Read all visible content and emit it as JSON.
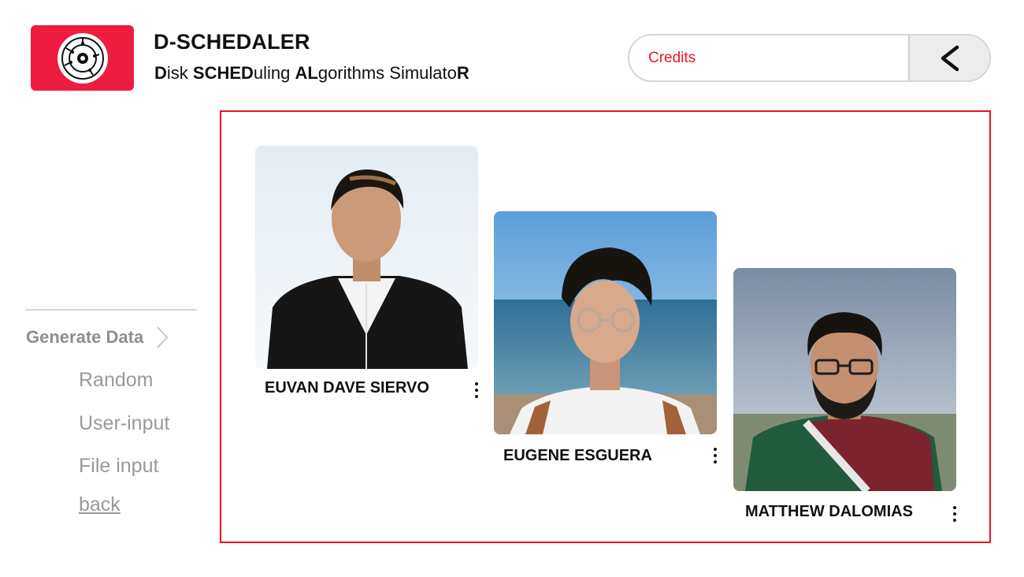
{
  "header": {
    "logo_icon": "disk-platter-icon",
    "title": "D-SCHEDALER",
    "subtitle_parts": [
      {
        "text": "D",
        "bold": true
      },
      {
        "text": "isk ",
        "bold": false
      },
      {
        "text": "SCHED",
        "bold": true
      },
      {
        "text": "uling ",
        "bold": false
      },
      {
        "text": "AL",
        "bold": true
      },
      {
        "text": "gorithms Simulato",
        "bold": false
      },
      {
        "text": "R",
        "bold": true
      }
    ]
  },
  "nav": {
    "credits_label": "Credits",
    "back_icon": "chevron-left-icon"
  },
  "sidebar": {
    "generate_label": "Generate Data",
    "generate_icon": "chevron-right-icon",
    "items": [
      {
        "label": "Random"
      },
      {
        "label": "User-input"
      },
      {
        "label": "File input"
      },
      {
        "label": "back"
      }
    ]
  },
  "credits": {
    "members": [
      {
        "name": "EUVAN DAVE SIERVO",
        "photo": "portrait-suit-studio"
      },
      {
        "name": "EUGENE ESGUERA",
        "photo": "portrait-beach-glasses"
      },
      {
        "name": "MATTHEW DALOMIAS",
        "photo": "portrait-outdoor-cloudy"
      }
    ],
    "menu_icon": "more-vertical-icon"
  },
  "colors": {
    "accent": "#ee1c3f",
    "credits_text": "#e8141f",
    "panel_border": "#e8141f",
    "muted_text": "#999999"
  }
}
